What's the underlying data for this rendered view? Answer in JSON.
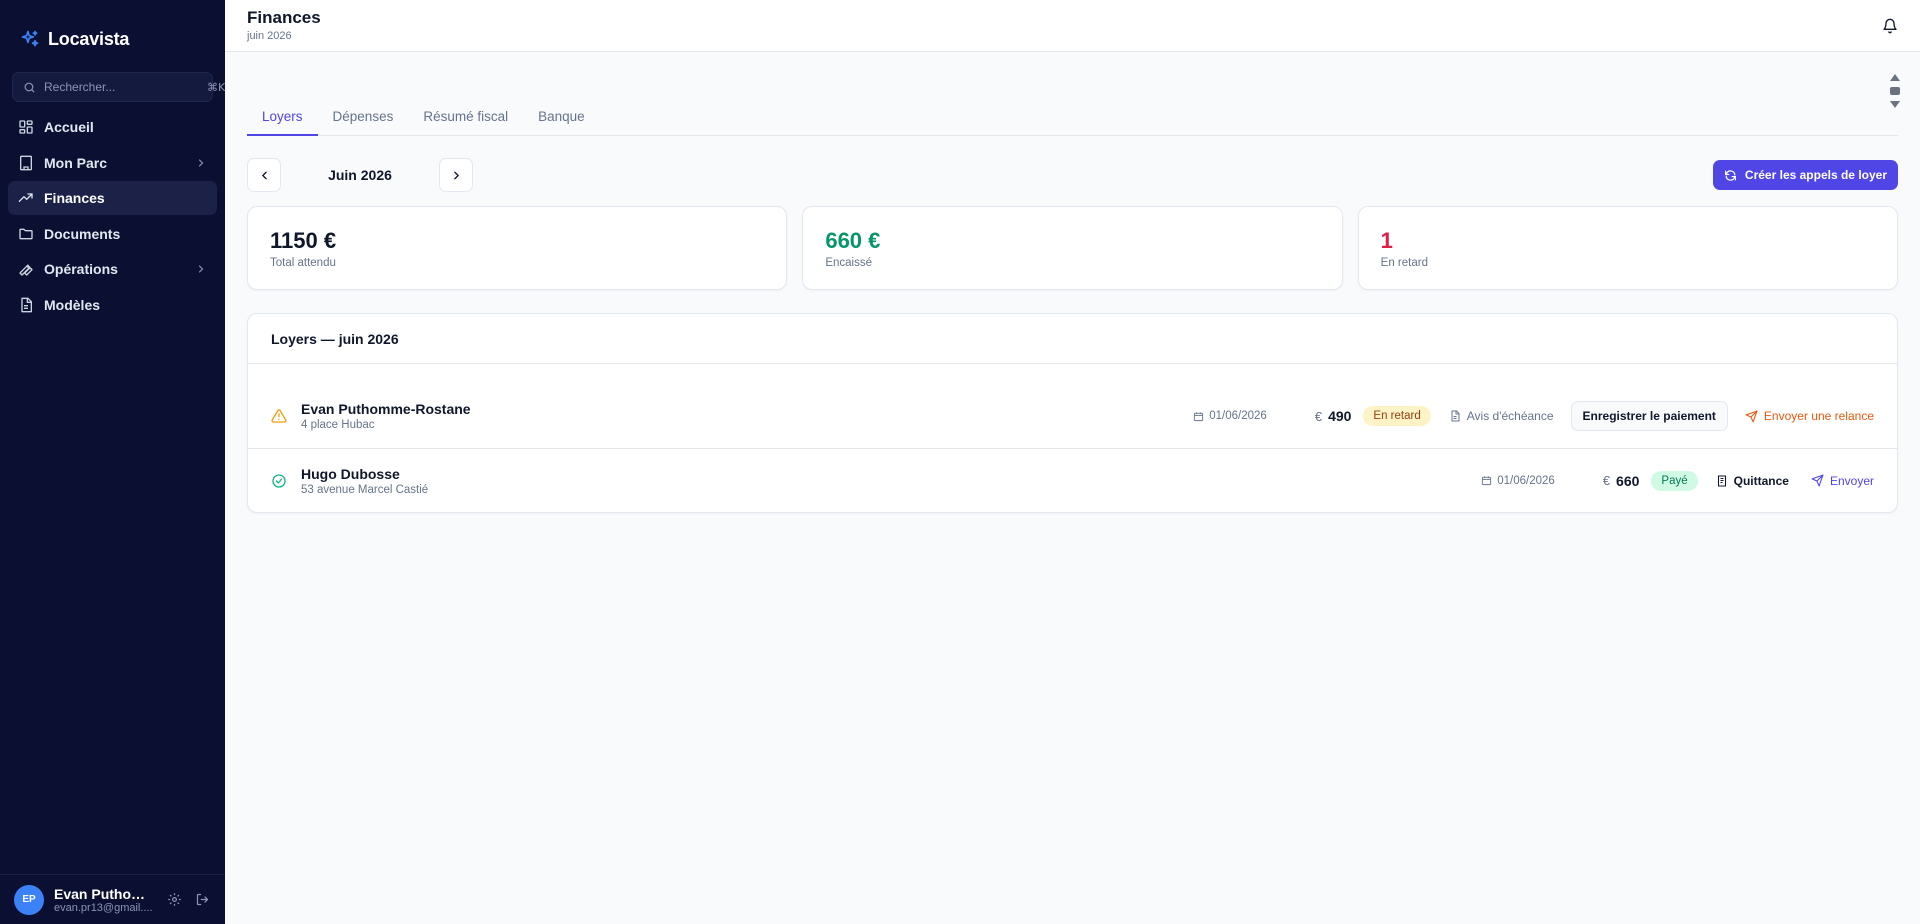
{
  "app": {
    "name": "Locavista",
    "brand_color": "#3b82f6",
    "accent": "#4f46e5"
  },
  "sidebar": {
    "search": {
      "placeholder": "Rechercher...",
      "shortcut": "⌘K"
    },
    "items": [
      {
        "label": "Accueil",
        "icon": "grid-icon",
        "has_chevron": false,
        "active": false
      },
      {
        "label": "Mon Parc",
        "icon": "building-icon",
        "has_chevron": true,
        "active": false
      },
      {
        "label": "Finances",
        "icon": "trending-up-icon",
        "has_chevron": false,
        "active": true
      },
      {
        "label": "Documents",
        "icon": "folder-icon",
        "has_chevron": false,
        "active": false
      },
      {
        "label": "Opérations",
        "icon": "wrench-icon",
        "has_chevron": true,
        "active": false
      },
      {
        "label": "Modèles",
        "icon": "file-icon",
        "has_chevron": false,
        "active": false
      }
    ],
    "user": {
      "initials": "EP",
      "name": "Evan Puthom...",
      "email": "evan.pr13@gmail...."
    }
  },
  "header": {
    "title": "Finances",
    "subtitle": "juin 2026"
  },
  "tabs": [
    {
      "label": "Loyers",
      "active": true
    },
    {
      "label": "Dépenses",
      "active": false
    },
    {
      "label": "Résumé fiscal",
      "active": false
    },
    {
      "label": "Banque",
      "active": false
    }
  ],
  "period": {
    "label": "Juin 2026"
  },
  "create_button": {
    "label": "Créer les appels de loyer"
  },
  "stats": [
    {
      "value": "1150 €",
      "label": "Total attendu",
      "color": "#0f172a"
    },
    {
      "value": "660 €",
      "label": "Encaissé",
      "color": "#059669"
    },
    {
      "value": "1",
      "label": "En retard",
      "color": "#e11d48"
    }
  ],
  "rents": {
    "title": "Loyers — juin 2026",
    "rows": [
      {
        "status": "late",
        "status_icon": "warning-icon",
        "name": "Evan Puthomme-Rostane",
        "address": "4 place Hubac",
        "due_date": "01/06/2026",
        "currency": "€",
        "amount": "490",
        "badge": "En retard",
        "doc_label": "Avis d'échéance",
        "record_label": "Enregistrer le paiement",
        "send_label": "Envoyer une relance"
      },
      {
        "status": "paid",
        "status_icon": "check-circle-icon",
        "name": "Hugo Dubosse",
        "address": "53 avenue Marcel Castié",
        "due_date": "01/06/2026",
        "currency": "€",
        "amount": "660",
        "badge": "Payé",
        "doc_label": "Quittance",
        "send_label": "Envoyer"
      }
    ]
  }
}
